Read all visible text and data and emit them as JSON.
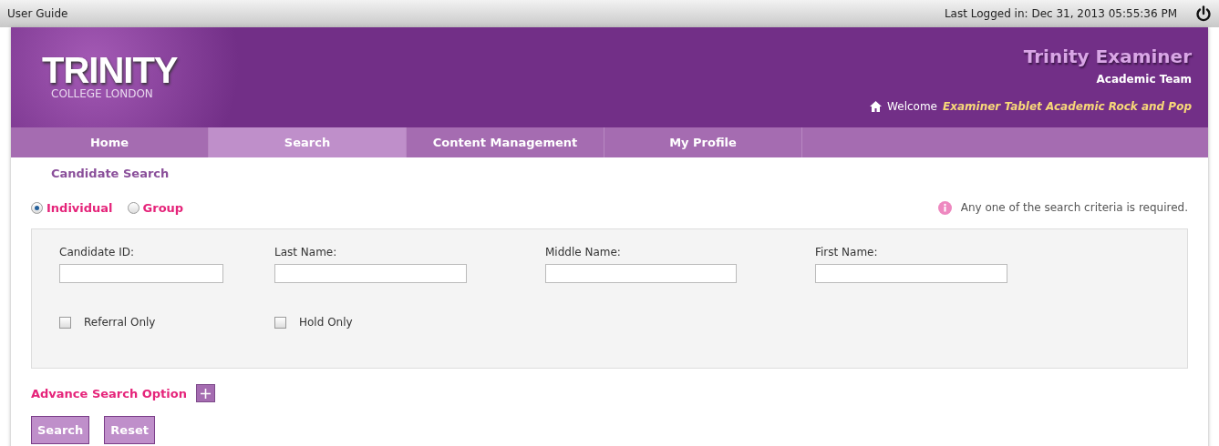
{
  "top_bar": {
    "user_guide": "User Guide",
    "last_logged": "Last Logged in: Dec 31, 2013 05:55:36 PM"
  },
  "header": {
    "logo_title": "TRINITY",
    "logo_subtitle": "COLLEGE LONDON",
    "app_title": "Trinity Examiner",
    "team": "Academic Team",
    "welcome": "Welcome",
    "user": "Examiner Tablet Academic Rock and Pop"
  },
  "tabs": [
    {
      "label": "Home",
      "selected": false
    },
    {
      "label": "Search",
      "selected": true
    },
    {
      "label": "Content Management",
      "selected": false
    },
    {
      "label": "My Profile",
      "selected": false
    }
  ],
  "page_title": "Candidate Search",
  "search_type": [
    {
      "label": "Individual",
      "selected": true
    },
    {
      "label": "Group",
      "selected": false
    }
  ],
  "info_note": "Any one of the search criteria is required.",
  "fields": [
    {
      "label": "Candidate ID:"
    },
    {
      "label": "Last Name:"
    },
    {
      "label": "Middle Name:"
    },
    {
      "label": "First Name:"
    }
  ],
  "checkboxes": [
    {
      "label": "Referral Only",
      "checked": false
    },
    {
      "label": "Hold Only",
      "checked": false
    }
  ],
  "advance_option": "Advance Search Option",
  "buttons": [
    "Search",
    "Reset"
  ]
}
